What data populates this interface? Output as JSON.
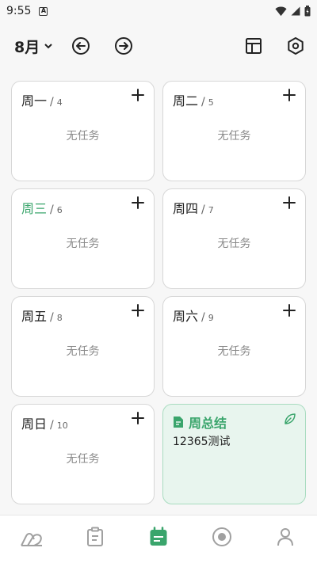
{
  "status": {
    "time": "9:55",
    "notification_glyph": "A"
  },
  "header": {
    "month": "8月"
  },
  "days": [
    {
      "name": "周一",
      "date": "4",
      "empty": "无任务"
    },
    {
      "name": "周二",
      "date": "5",
      "empty": "无任务"
    },
    {
      "name": "周三",
      "date": "6",
      "empty": "无任务"
    },
    {
      "name": "周四",
      "date": "7",
      "empty": "无任务"
    },
    {
      "name": "周五",
      "date": "8",
      "empty": "无任务"
    },
    {
      "name": "周六",
      "date": "9",
      "empty": "无任务"
    },
    {
      "name": "周日",
      "date": "10",
      "empty": "无任务"
    }
  ],
  "summary": {
    "title": "周总结",
    "content": "12365测试"
  },
  "icons": {
    "back": "arrow-left-circle-icon",
    "forward": "arrow-right-circle-icon",
    "layout": "layout-icon",
    "settings": "settings-icon",
    "add": "plus-icon",
    "summary": "document-icon",
    "edit": "leaf-pen-icon",
    "nav": [
      "home-icon",
      "clipboard-icon",
      "calendar-icon",
      "focus-icon",
      "profile-icon"
    ]
  },
  "colors": {
    "accent": "#3aa56c",
    "summary_bg": "#e8f5ee",
    "text": "#222222",
    "muted": "#8a8a8a"
  }
}
